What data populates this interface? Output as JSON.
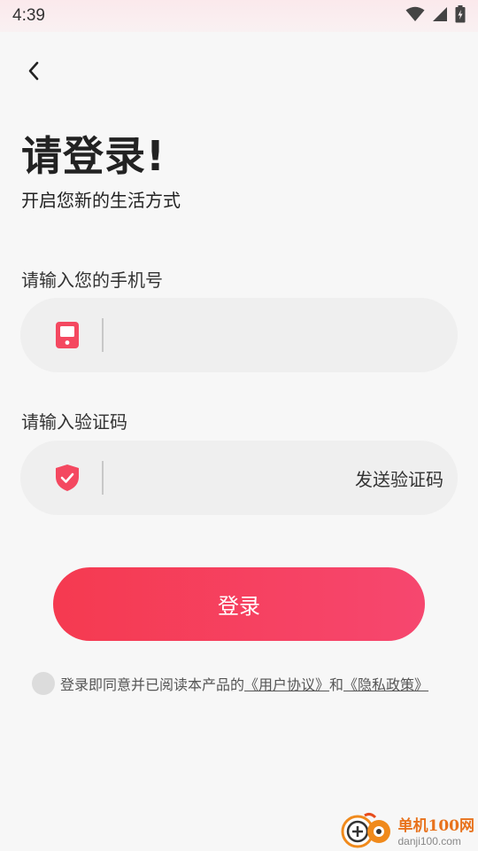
{
  "status_bar": {
    "time": "4:39",
    "icons": [
      "wifi-icon",
      "signal-icon",
      "battery-icon"
    ]
  },
  "header": {
    "back_icon": "chevron-left-icon",
    "title": "请登录!",
    "subtitle": "开启您新的生活方式"
  },
  "phone": {
    "label": "请输入您的手机号",
    "icon": "phone-icon",
    "value": "",
    "placeholder": ""
  },
  "code": {
    "label": "请输入验证码",
    "icon": "shield-check-icon",
    "value": "",
    "placeholder": "",
    "send_label": "发送验证码"
  },
  "login_button": {
    "label": "登录"
  },
  "agreement": {
    "checked": false,
    "text": "登录即同意并已阅读本产品的",
    "link_user": "《用户协议》",
    "and": "和",
    "link_privacy": "《隐私政策》"
  },
  "watermark": {
    "name": "单机100网",
    "url": "danji100.com"
  },
  "colors": {
    "accent": "#f53a50",
    "accent_end": "#f6476f",
    "field_bg": "#efefef",
    "page_bg": "#f7f7f7"
  }
}
